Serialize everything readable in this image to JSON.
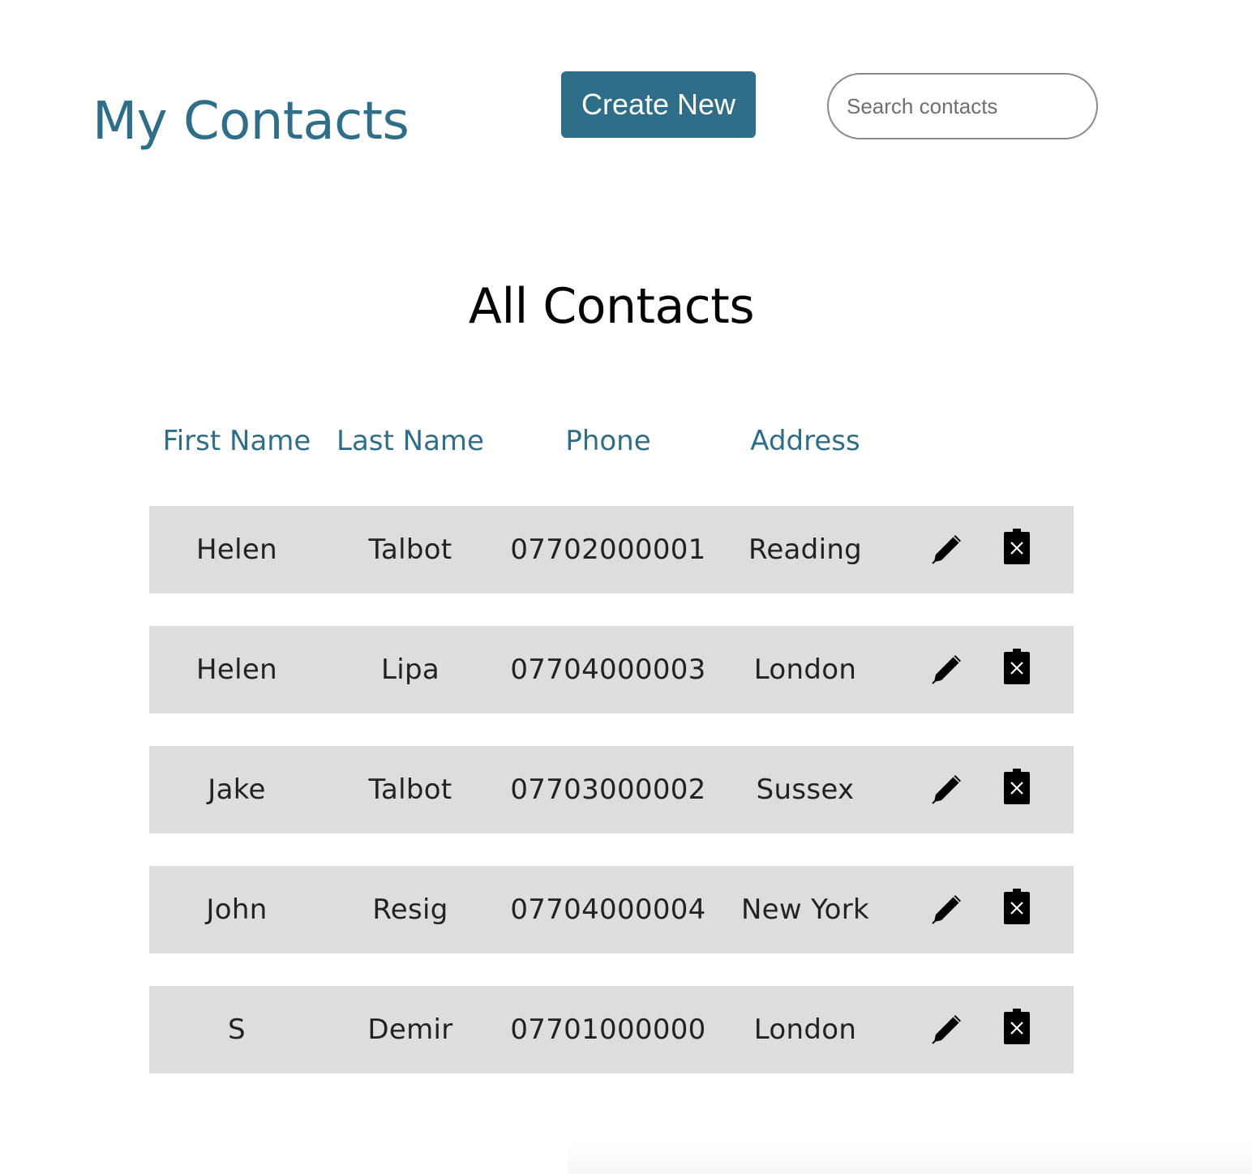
{
  "header": {
    "title": "My Contacts",
    "create_label": "Create New",
    "search_placeholder": "Search contacts",
    "search_value": ""
  },
  "main": {
    "section_title": "All Contacts",
    "columns": {
      "first_name": "First Name",
      "last_name": "Last Name",
      "phone": "Phone",
      "address": "Address"
    },
    "contacts": [
      {
        "first_name": "Helen",
        "last_name": "Talbot",
        "phone": "07702000001",
        "address": "Reading"
      },
      {
        "first_name": "Helen",
        "last_name": "Lipa",
        "phone": "07704000003",
        "address": "London"
      },
      {
        "first_name": "Jake",
        "last_name": "Talbot",
        "phone": "07703000002",
        "address": "Sussex"
      },
      {
        "first_name": "John",
        "last_name": "Resig",
        "phone": "07704000004",
        "address": "New York"
      },
      {
        "first_name": "S",
        "last_name": "Demir",
        "phone": "07701000000",
        "address": "London"
      }
    ],
    "row_actions": [
      "pencil-icon",
      "trash-x-icon"
    ]
  },
  "colors": {
    "accent": "#2f6e88",
    "row_background": "#dddddd",
    "heading": "#000000",
    "text": "#222222"
  }
}
